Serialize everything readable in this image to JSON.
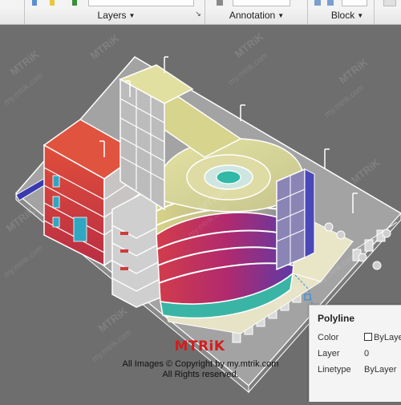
{
  "ribbon": {
    "panels": [
      {
        "label": "Layers"
      },
      {
        "label": "Annotation"
      },
      {
        "label": "Block"
      }
    ]
  },
  "watermark": {
    "brand": "MTRiK",
    "site": "my.mtrik.com"
  },
  "logo": {
    "text": "MTRiK"
  },
  "copyright": {
    "line1": "All Images © Copyright by my.mtrik.com",
    "line2": "All Rights reserved."
  },
  "tooltip": {
    "title": "Polyline",
    "rows": [
      {
        "name": "Color",
        "value": "ByLayer",
        "has_swatch": true
      },
      {
        "name": "Layer",
        "value": "0"
      },
      {
        "name": "Linetype",
        "value": "ByLayer"
      }
    ],
    "swatch_color": "#ffffff"
  },
  "colors": {
    "viewport_bg": "#6e6e6e",
    "ground": "#a0a0a0",
    "edge": "#ffffff",
    "red_facade": "#d9443a",
    "magenta_facade": "#b22a6b",
    "yellow_roof": "#d8d895",
    "teal": "#2fb9a6",
    "blue_accent": "#3a3ab0"
  }
}
